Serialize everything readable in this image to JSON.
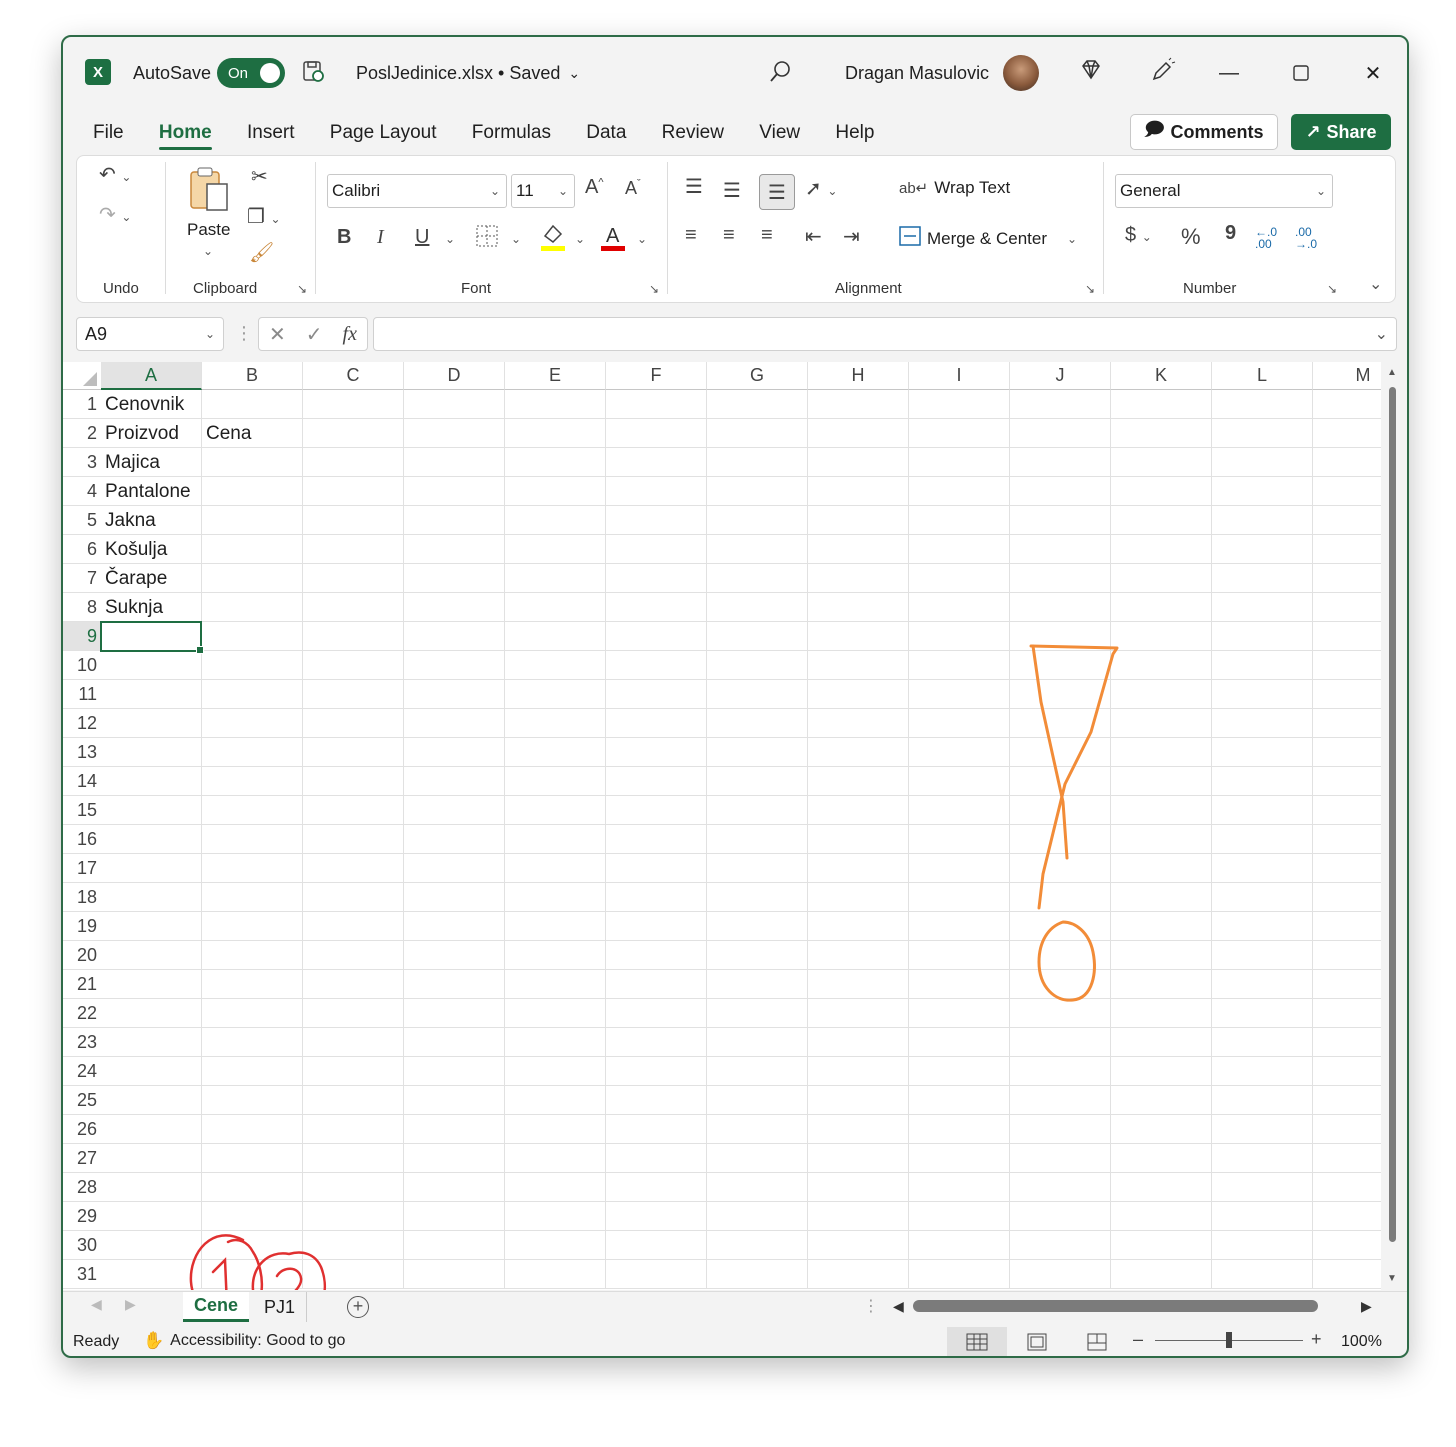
{
  "titlebar": {
    "app_icon": "X",
    "autosave_label": "AutoSave",
    "autosave_state": "On",
    "filename": "PoslJedinice.xlsx • Saved",
    "username": "Dragan Masulovic",
    "icons": [
      "excel-logo-icon",
      "save-sync-icon",
      "search-icon",
      "diamond-icon",
      "pen-icon",
      "minimize-icon",
      "maximize-icon",
      "close-icon"
    ]
  },
  "menu": {
    "items": [
      "File",
      "Home",
      "Insert",
      "Page Layout",
      "Formulas",
      "Data",
      "Review",
      "View",
      "Help"
    ],
    "active": "Home",
    "comments_label": "Comments",
    "share_label": "Share"
  },
  "ribbon": {
    "groups": {
      "undo": "Undo",
      "clipboard": "Clipboard",
      "font": "Font",
      "alignment": "Alignment",
      "number": "Number"
    },
    "paste_label": "Paste",
    "font_name": "Calibri",
    "font_size": "11",
    "wrap_text": "Wrap Text",
    "merge_center": "Merge & Center",
    "number_format": "General",
    "font_buttons": {
      "bold": "B",
      "italic": "I",
      "underline": "U"
    },
    "number_buttons": {
      "currency": "$",
      "percent": "%",
      "comma": "9"
    },
    "highlight_color": "#ffff00",
    "font_color": "#e00000"
  },
  "formula_bar": {
    "name_box": "A9",
    "fx_label": "fx",
    "value": ""
  },
  "sheet": {
    "columns": [
      "A",
      "B",
      "C",
      "D",
      "E",
      "F",
      "G",
      "H",
      "I",
      "J",
      "K",
      "L",
      "M"
    ],
    "rows": [
      "1",
      "2",
      "3",
      "4",
      "5",
      "6",
      "7",
      "8",
      "9",
      "10",
      "11",
      "12",
      "13",
      "14",
      "15",
      "16",
      "17",
      "18",
      "19",
      "20",
      "21",
      "22",
      "23",
      "24",
      "25",
      "26",
      "27",
      "28",
      "29",
      "30",
      "31"
    ],
    "cells": {
      "A1": "Cenovnik",
      "A2": "Proizvod",
      "B2": "Cena",
      "A3": "Majica",
      "A4": "Pantalone",
      "A5": "Jakna",
      "A6": "Košulja",
      "A7": "Čarape",
      "A8": "Suknja"
    },
    "selected_cell": "A9",
    "annotation_colors": {
      "exclamation": "#f28c38",
      "circles": "#e03030"
    }
  },
  "tabs": {
    "sheets": [
      "Cene",
      "PJ1"
    ],
    "active": "Cene"
  },
  "status": {
    "ready": "Ready",
    "accessibility": "Accessibility: Good to go",
    "zoom": "100%",
    "zoom_level": 1.0
  }
}
